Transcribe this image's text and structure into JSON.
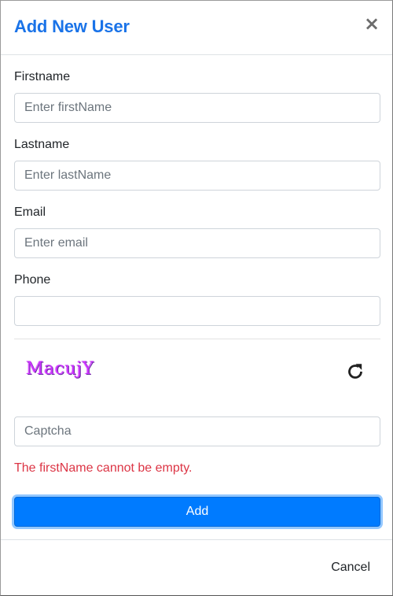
{
  "dialog": {
    "title": "Add New User",
    "close_label": "×"
  },
  "form": {
    "firstname": {
      "label": "Firstname",
      "placeholder": "Enter firstName",
      "value": ""
    },
    "lastname": {
      "label": "Lastname",
      "placeholder": "Enter lastName",
      "value": ""
    },
    "email": {
      "label": "Email",
      "placeholder": "Enter email",
      "value": ""
    },
    "phone": {
      "label": "Phone",
      "placeholder": "",
      "value": ""
    },
    "captcha": {
      "image_text": "MacujY",
      "input_placeholder": "Captcha",
      "refresh_icon": "refresh-icon"
    },
    "error_message": "The firstName cannot be empty.",
    "submit_label": "Add"
  },
  "footer": {
    "cancel_label": "Cancel"
  },
  "colors": {
    "title": "#1a73e8",
    "primary_button": "#007bff",
    "error": "#dc3545",
    "captcha": "#cc33ff"
  }
}
